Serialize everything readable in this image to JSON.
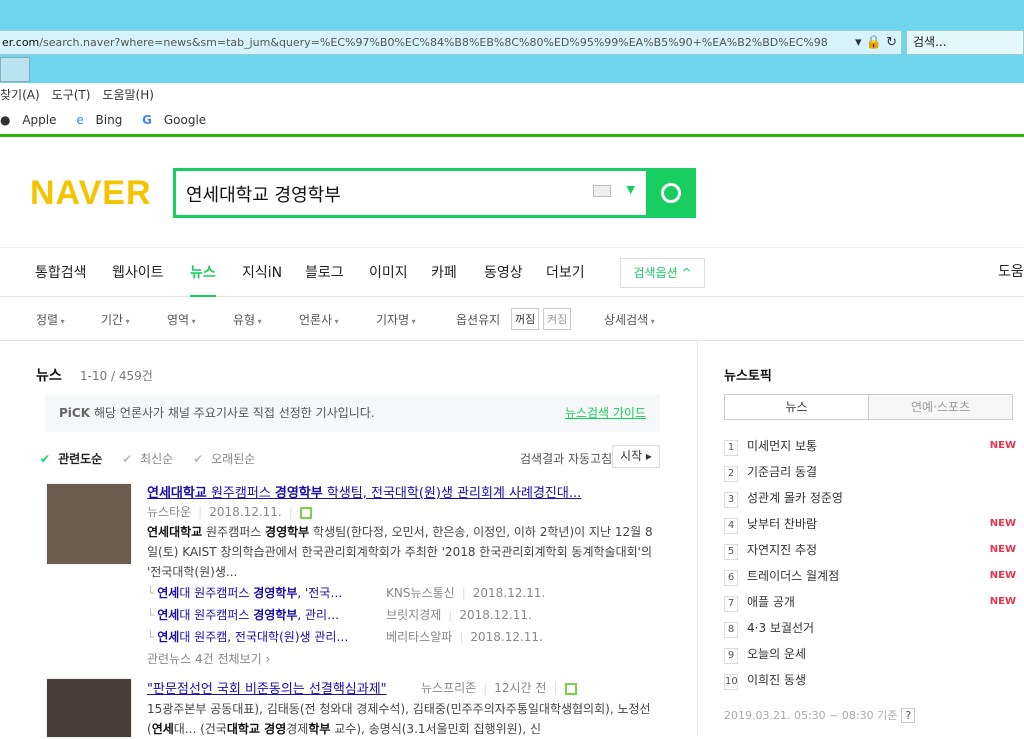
{
  "browser": {
    "url_domain": "er.com",
    "url_rest": "/search.naver?where=news&sm=tab_jum&query=%EC%97%B0%EC%84%B8%EB%8C%80%ED%95%99%EA%B5%90+%EA%B2%BD%EC%98",
    "web_search_placeholder": "검색...",
    "menu": [
      "찾기(A)",
      "도구(T)",
      "도움말(H)"
    ],
    "favorites": [
      "Apple",
      "Bing",
      "Google"
    ]
  },
  "logo": "NAVER",
  "search": {
    "query": "연세대학교 경영학부"
  },
  "nav": {
    "items": [
      "통합검색",
      "웹사이트",
      "뉴스",
      "지식iN",
      "블로그",
      "이미지",
      "카페",
      "동영상",
      "더보기"
    ],
    "options_label": "검색옵션 ^",
    "help": "도움"
  },
  "filters": {
    "items": [
      "정렬",
      "기간",
      "영역",
      "유형",
      "언론사",
      "기자명"
    ],
    "keep_label": "옵션유지",
    "off": "꺼짐",
    "on": "켜짐",
    "detail": "상세검색"
  },
  "news": {
    "heading": "뉴스",
    "count": "1-10 / 459건",
    "pick_label": "PiCK",
    "pick_text": "해당 언론사가 채널 주요기사로 직접 선정한 기사입니다.",
    "guide_link": "뉴스검색 가이드",
    "sorts": [
      "관련도순",
      "최신순",
      "오래된순"
    ],
    "auto_refresh": "검색결과 자동고침",
    "start": "시작 ▸",
    "articles": [
      {
        "title": [
          {
            "t": "연세대학교",
            "b": true
          },
          {
            "t": " 원주캠퍼스 "
          },
          {
            "t": "경영학부",
            "b": true
          },
          {
            "t": " 학생팀, 전국대학(원)생 관리회계 사례경진대..."
          }
        ],
        "source": "뉴스타운",
        "date": "2018.12.11.",
        "desc": [
          {
            "t": "연세대학교",
            "b": true
          },
          {
            "t": " 원주캠퍼스 "
          },
          {
            "t": "경영학부",
            "b": true
          },
          {
            "t": " 학생팀(한다정, 오민서, 한은송, 이정인, 이하 2학년)이 지난 12월 8일(토) KAIST 창의학습관에서 한국관리회계학회가 주최한 '2018 한국관리회계학회 동계학술대회'의 '전국대학(원)생..."
          }
        ],
        "related": [
          {
            "title": [
              {
                "t": "연세",
                "b": true
              },
              {
                "t": "대 원주캠퍼스 "
              },
              {
                "t": "경영학부",
                "b": true
              },
              {
                "t": ", '전국…"
              }
            ],
            "source": "KNS뉴스통신",
            "date": "2018.12.11."
          },
          {
            "title": [
              {
                "t": "연세",
                "b": true
              },
              {
                "t": "대 원주캠퍼스 "
              },
              {
                "t": "경영학부",
                "b": true
              },
              {
                "t": ", 관리…"
              }
            ],
            "source": "브릿지경제",
            "date": "2018.12.11."
          },
          {
            "title": [
              {
                "t": "연세",
                "b": true
              },
              {
                "t": "대 원주캠, 전국대학(원)생 관리…"
              }
            ],
            "source": "베리타스알파",
            "date": "2018.12.11."
          }
        ],
        "more": "관련뉴스 4건 전체보기 ›"
      },
      {
        "title": [
          {
            "t": "\"판문점선언 국회 비준동의는 선결핵심과제\""
          }
        ],
        "source": "뉴스프리존",
        "date": "12시간 전",
        "desc": [
          {
            "t": "15광주본부 공동대표), 김태동(전 청와대 경제수석), 김태중(민주주의자주통일대학생협의회), 노정선("
          },
          {
            "t": "연세",
            "b": true
          },
          {
            "t": "대... (건국"
          },
          {
            "t": "대학교 경영",
            "b": true
          },
          {
            "t": "경제"
          },
          {
            "t": "학부",
            "b": true
          },
          {
            "t": " 교수), 송명식(3.1서울민회 집행위원), 신"
          }
        ]
      }
    ]
  },
  "topics": {
    "title": "뉴스토픽",
    "tabs": [
      "뉴스",
      "연예·스포츠"
    ],
    "items": [
      {
        "n": "1",
        "t": "미세먼지 보통",
        "new": "NEW"
      },
      {
        "n": "2",
        "t": "기준금리 동결"
      },
      {
        "n": "3",
        "t": "성관계 몰카 정준영"
      },
      {
        "n": "4",
        "t": "낮부터 찬바람",
        "new": "NEW"
      },
      {
        "n": "5",
        "t": "자연지진 추정",
        "new": "NEW"
      },
      {
        "n": "6",
        "t": "트레이더스 월계점",
        "new": "NEW"
      },
      {
        "n": "7",
        "t": "애플 공개",
        "new": "NEW"
      },
      {
        "n": "8",
        "t": "4·3 보궐선거"
      },
      {
        "n": "9",
        "t": "오늘의 운세"
      },
      {
        "n": "10",
        "t": "이희진 동생"
      }
    ],
    "timestamp": "2019.03.21. 05:30 ~ 08:30 기준",
    "help": "?"
  },
  "colors": {
    "accent": "#19ce60",
    "link": "#1a0dab",
    "new": "#e8344d",
    "chrome": "#6dd5ec"
  }
}
